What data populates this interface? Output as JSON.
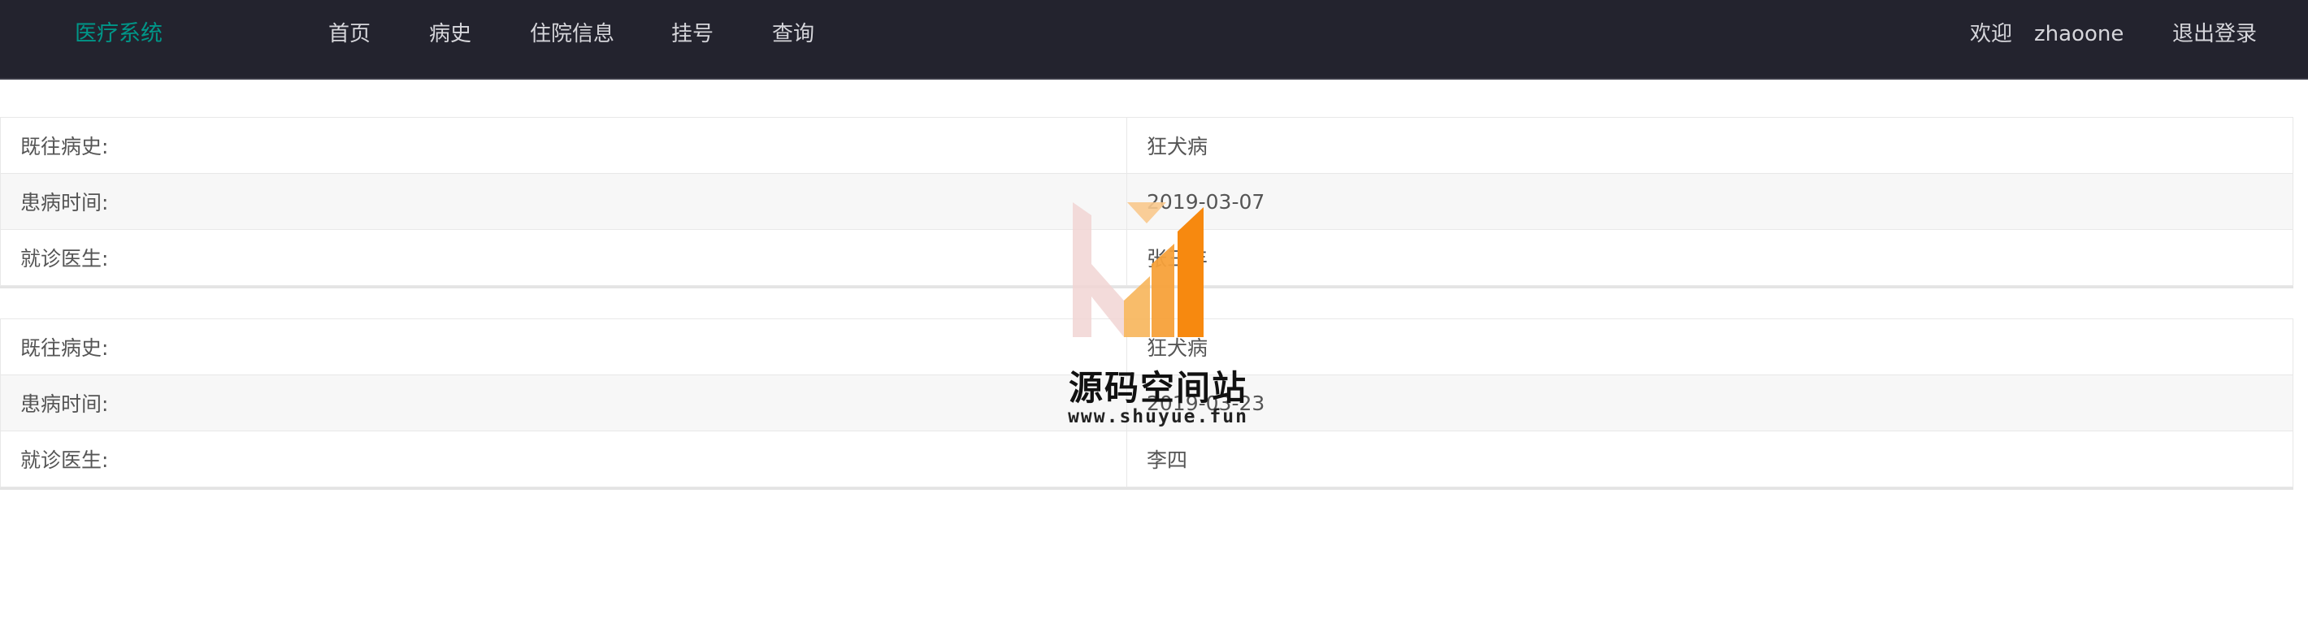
{
  "header": {
    "brand": "医疗系统",
    "nav": [
      "首页",
      "病史",
      "住院信息",
      "挂号",
      "查询"
    ],
    "welcome": "欢迎",
    "username": "zhaoone",
    "logout": "退出登录"
  },
  "records": [
    {
      "rows": [
        {
          "label": "既往病史:",
          "value": "狂犬病"
        },
        {
          "label": "患病时间:",
          "value": "2019-03-07"
        },
        {
          "label": "就诊医生:",
          "value": "张三丰"
        }
      ]
    },
    {
      "rows": [
        {
          "label": "既往病史:",
          "value": "狂犬病"
        },
        {
          "label": "患病时间:",
          "value": "2019-03-23"
        },
        {
          "label": "就诊医生:",
          "value": "李四"
        }
      ]
    }
  ],
  "watermark": {
    "title": "源码空间站",
    "url": "www.shuyue.fun"
  },
  "colors": {
    "topbar": "#23232e",
    "brand": "#009688",
    "watermark_orange": "#f7890f",
    "watermark_pink": "#f1d5d3"
  }
}
